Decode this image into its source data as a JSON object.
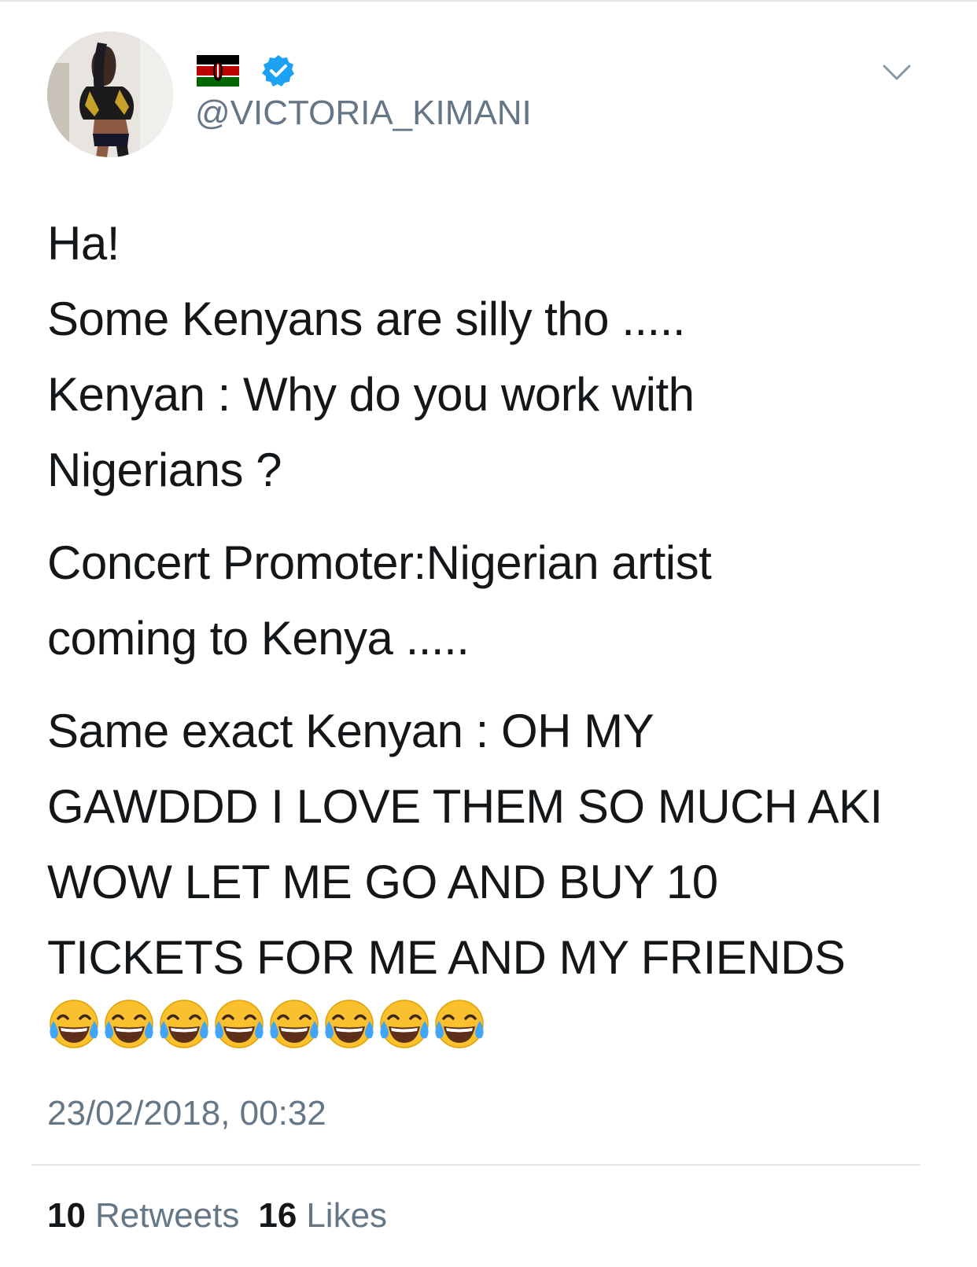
{
  "author": {
    "handle": "@VICTORIA_KIMANI",
    "flag_icon": "kenya-flag-icon",
    "verified_icon": "verified-badge-icon",
    "verified_color": "#1da1f2"
  },
  "menu_icon": "chevron-down-icon",
  "tweet": {
    "paragraphs": [
      {
        "lines": [
          "Ha!",
          "Some Kenyans are silly tho .....",
          "Kenyan : Why do you work with",
          "Nigerians ?"
        ]
      },
      {
        "lines": [
          "Concert Promoter:Nigerian artist",
          "coming to Kenya ....."
        ]
      },
      {
        "lines": [
          "Same exact Kenyan : OH MY",
          "GAWDDD I LOVE THEM SO MUCH AKI",
          "WOW LET ME GO AND BUY 10",
          "TICKETS FOR ME AND MY FRIENDS"
        ]
      }
    ],
    "emoji": "face-with-tears-of-joy",
    "emoji_count": 8
  },
  "timestamp": "23/02/2018, 00:32",
  "stats": {
    "retweets_count": "10",
    "retweets_label": "Retweets",
    "likes_count": "16",
    "likes_label": "Likes"
  },
  "colors": {
    "text": "#14171a",
    "secondary": "#657786",
    "divider": "#e1e8ed"
  }
}
